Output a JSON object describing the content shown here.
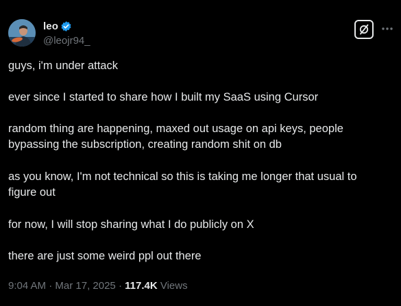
{
  "author": {
    "display_name": "leo",
    "handle": "@leojr94_",
    "verified_color": "#1d9bf0"
  },
  "header_actions": {
    "grok_icon": "grok-slash-icon",
    "more_icon": "more-horizontal-icon"
  },
  "tweet": {
    "lines": [
      "guys, i'm under attack",
      "ever since I started to share how I built my SaaS using Cursor",
      "random thing are happening, maxed out usage on api keys, people",
      "bypassing the subscription, creating random shit on db",
      "as you know, I'm not technical so this is taking me longer that usual to",
      "figure out",
      "for now, I will stop sharing what I do publicly on X",
      "there are just some weird ppl out there"
    ]
  },
  "meta": {
    "time": "9:04 AM",
    "separator": "·",
    "date": "Mar 17, 2025",
    "views_count": "117.4K",
    "views_label": "Views"
  },
  "colors": {
    "background": "#000000",
    "text": "#e7e9ea",
    "secondary": "#71767b"
  }
}
